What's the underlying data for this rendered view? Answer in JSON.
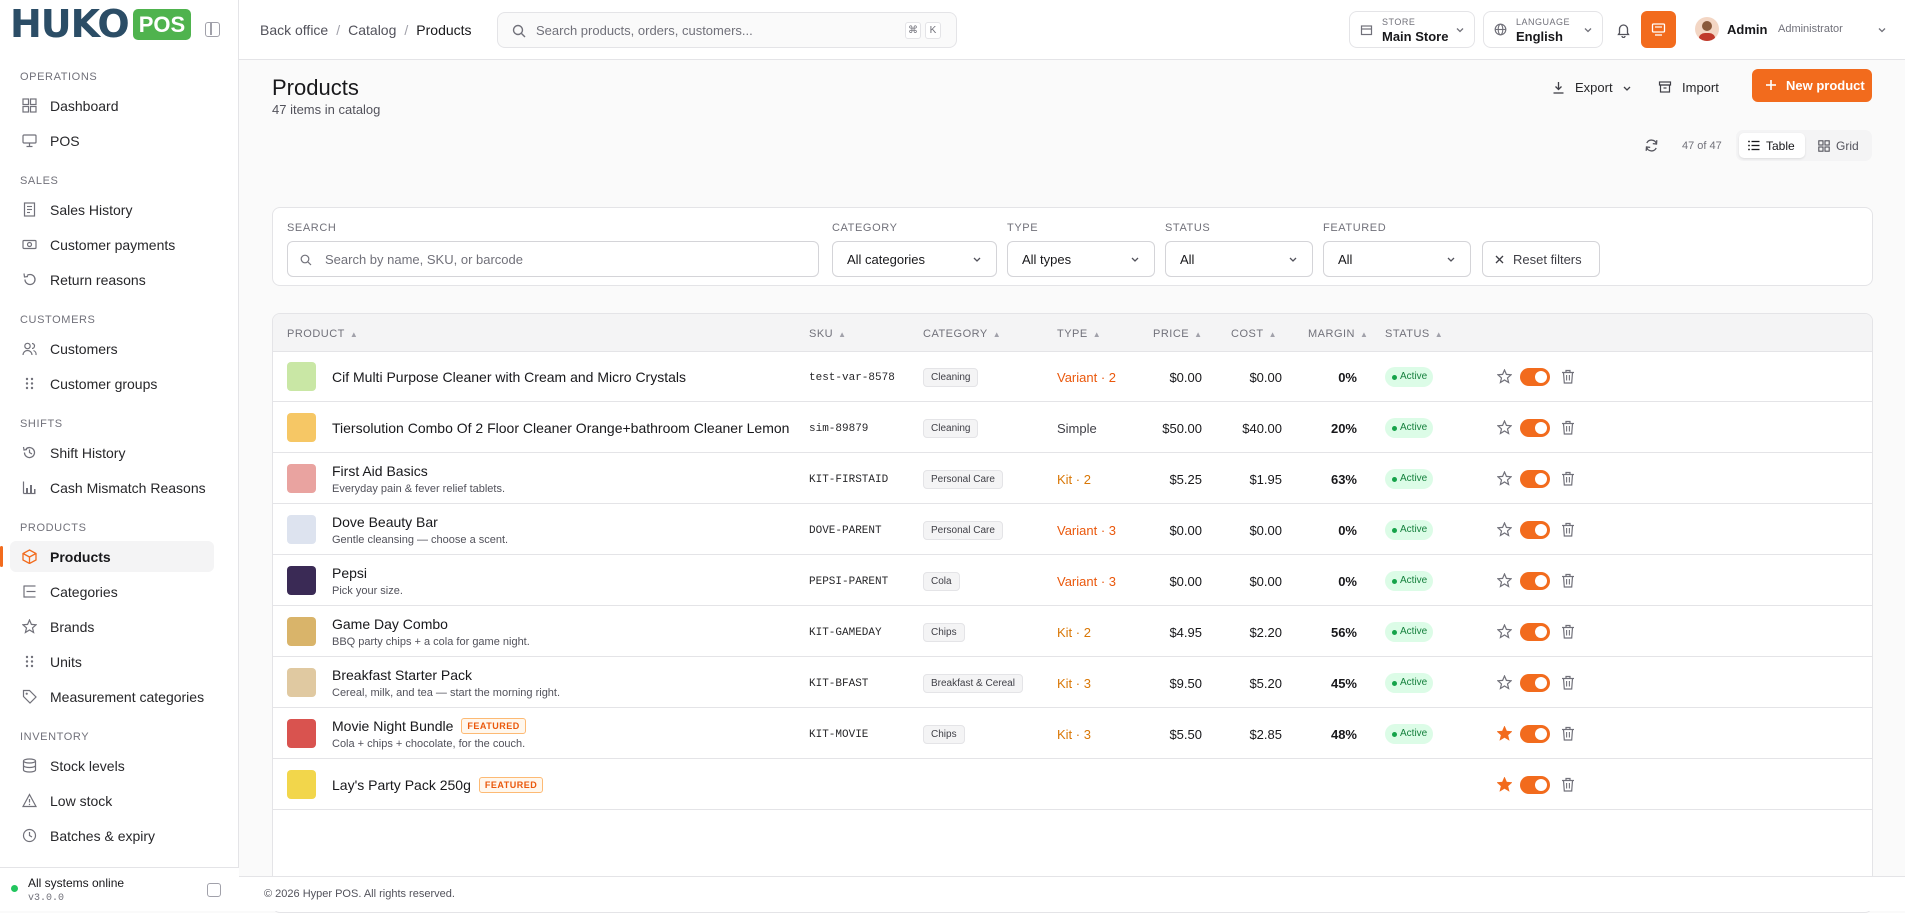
{
  "app": {
    "brand": "HUKO",
    "brand_suffix": "POS"
  },
  "sidebar": {
    "sections": [
      {
        "title": "OPERATIONS",
        "items": [
          {
            "label": "Dashboard",
            "icon": "dashboard-icon"
          },
          {
            "label": "POS",
            "icon": "monitor-icon"
          }
        ]
      },
      {
        "title": "SALES",
        "items": [
          {
            "label": "Sales History",
            "icon": "receipt-icon"
          },
          {
            "label": "Customer payments",
            "icon": "cash-icon"
          },
          {
            "label": "Return reasons",
            "icon": "undo-icon"
          }
        ]
      },
      {
        "title": "CUSTOMERS",
        "items": [
          {
            "label": "Customers",
            "icon": "users-icon"
          },
          {
            "label": "Customer groups",
            "icon": "grip-icon"
          }
        ]
      },
      {
        "title": "SHIFTS",
        "items": [
          {
            "label": "Shift History",
            "icon": "history-icon"
          },
          {
            "label": "Cash Mismatch Reasons",
            "icon": "bar-chart-icon"
          }
        ]
      },
      {
        "title": "PRODUCTS",
        "items": [
          {
            "label": "Products",
            "icon": "box-icon",
            "active": true
          },
          {
            "label": "Categories",
            "icon": "list-tree-icon"
          },
          {
            "label": "Brands",
            "icon": "star-icon"
          },
          {
            "label": "Units",
            "icon": "grip-icon"
          },
          {
            "label": "Measurement categories",
            "icon": "tag-icon"
          }
        ]
      },
      {
        "title": "INVENTORY",
        "items": [
          {
            "label": "Stock levels",
            "icon": "database-icon"
          },
          {
            "label": "Low stock",
            "icon": "alert-icon"
          },
          {
            "label": "Batches & expiry",
            "icon": "clock-icon"
          }
        ]
      }
    ],
    "status": "All systems online",
    "version": "v3.0.0"
  },
  "topbar": {
    "breadcrumbs": [
      "Back office",
      "Catalog",
      "Products"
    ],
    "search_placeholder": "Search products, orders, customers...",
    "kbd_cmd": "⌘",
    "kbd_key": "K",
    "store_label": "STORE",
    "store_value": "Main Store",
    "language_label": "LANGUAGE",
    "language_value": "English",
    "user_name": "Admin",
    "user_role": "Administrator"
  },
  "page": {
    "title": "Products",
    "subtitle": "47 items in catalog",
    "export_label": "Export",
    "import_label": "Import",
    "new_label": "New product",
    "count_text": "47 of 47",
    "view_table": "Table",
    "view_grid": "Grid"
  },
  "filters": {
    "search_label": "SEARCH",
    "search_placeholder": "Search by name, SKU, or barcode",
    "category_label": "CATEGORY",
    "category_value": "All categories",
    "type_label": "TYPE",
    "type_value": "All types",
    "status_label": "STATUS",
    "status_value": "All",
    "featured_label": "FEATURED",
    "featured_value": "All",
    "reset_label": "Reset filters"
  },
  "table": {
    "columns": [
      "PRODUCT",
      "SKU",
      "CATEGORY",
      "TYPE",
      "PRICE",
      "COST",
      "MARGIN",
      "STATUS"
    ],
    "rows": [
      {
        "name": "Cif Multi Purpose Cleaner with Cream and Micro Crystals",
        "desc": "",
        "sku": "test-var-8578",
        "category": "Cleaning",
        "type": "Variant · 2",
        "type_kind": "var",
        "price": "$0.00",
        "cost": "$0.00",
        "margin": "0%",
        "status": "Active",
        "featured": false,
        "thumb_color": "#c9e7a5"
      },
      {
        "name": "Tiersolution Combo Of 2 Floor Cleaner Orange+bathroom Cleaner Lemon",
        "desc": "",
        "sku": "sim-89879",
        "category": "Cleaning",
        "type": "Simple",
        "type_kind": "simple",
        "price": "$50.00",
        "cost": "$40.00",
        "margin": "20%",
        "status": "Active",
        "featured": false,
        "thumb_color": "#f6c765"
      },
      {
        "name": "First Aid Basics",
        "desc": "Everyday pain & fever relief tablets.",
        "sku": "KIT-FIRSTAID",
        "category": "Personal Care",
        "type": "Kit · 2",
        "type_kind": "kit",
        "price": "$5.25",
        "cost": "$1.95",
        "margin": "63%",
        "status": "Active",
        "featured": false,
        "thumb_color": "#e9a3a0"
      },
      {
        "name": "Dove Beauty Bar",
        "desc": "Gentle cleansing — choose a scent.",
        "sku": "DOVE-PARENT",
        "category": "Personal Care",
        "type": "Variant · 3",
        "type_kind": "var",
        "price": "$0.00",
        "cost": "$0.00",
        "margin": "0%",
        "status": "Active",
        "featured": false,
        "thumb_color": "#dde3ef"
      },
      {
        "name": "Pepsi",
        "desc": "Pick your size.",
        "sku": "PEPSI-PARENT",
        "category": "Cola",
        "type": "Variant · 3",
        "type_kind": "var",
        "price": "$0.00",
        "cost": "$0.00",
        "margin": "0%",
        "status": "Active",
        "featured": false,
        "thumb_color": "#3a2a55"
      },
      {
        "name": "Game Day Combo",
        "desc": "BBQ party chips + a cola for game night.",
        "sku": "KIT-GAMEDAY",
        "category": "Chips",
        "type": "Kit · 2",
        "type_kind": "kit",
        "price": "$4.95",
        "cost": "$2.20",
        "margin": "56%",
        "status": "Active",
        "featured": false,
        "thumb_color": "#d9b46a"
      },
      {
        "name": "Breakfast Starter Pack",
        "desc": "Cereal, milk, and tea — start the morning right.",
        "sku": "KIT-BFAST",
        "category": "Breakfast & Cereal",
        "type": "Kit · 3",
        "type_kind": "kit",
        "price": "$9.50",
        "cost": "$5.20",
        "margin": "45%",
        "status": "Active",
        "featured": false,
        "thumb_color": "#e0c9a1"
      },
      {
        "name": "Movie Night Bundle",
        "desc": "Cola + chips + chocolate, for the couch.",
        "sku": "KIT-MOVIE",
        "category": "Chips",
        "type": "Kit · 3",
        "type_kind": "kit",
        "price": "$5.50",
        "cost": "$2.85",
        "margin": "48%",
        "status": "Active",
        "featured": true,
        "thumb_color": "#d9534f"
      },
      {
        "name": "Lay's Party Pack 250g",
        "desc": "",
        "sku": "",
        "category": "",
        "type": "",
        "type_kind": "kit",
        "price": "",
        "cost": "",
        "margin": "",
        "status": "",
        "featured": true,
        "thumb_color": "#f2d64b"
      }
    ],
    "featured_tag": "FEATURED"
  },
  "footer": {
    "copyright": "© 2026 Hyper POS. All rights reserved."
  },
  "colors": {
    "accent": "#f26b1d",
    "active_badge": "#dcfce7",
    "brand_navy": "#2b4d66",
    "brand_green": "#4fb34e"
  }
}
